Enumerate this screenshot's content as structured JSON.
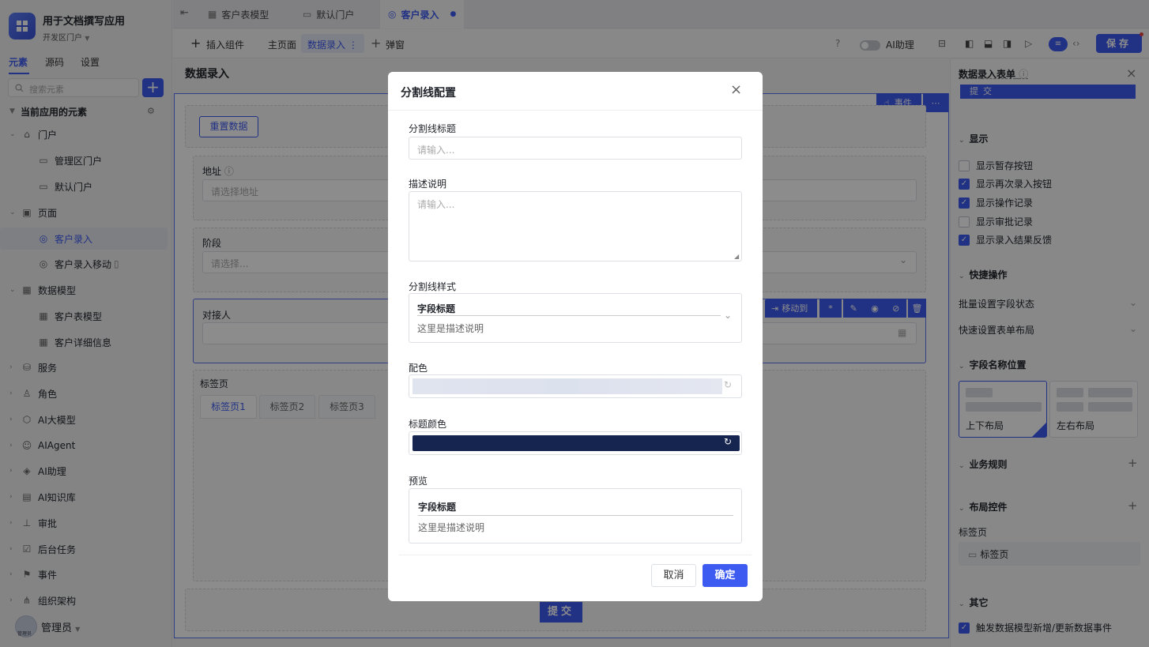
{
  "app": {
    "title": "用于文档撰写应用",
    "subtitle": "开发区门户"
  },
  "sidebar": {
    "tabs": [
      "元素",
      "源码",
      "设置"
    ],
    "search_placeholder": "搜索元素",
    "section_title": "当前应用的元素",
    "items": [
      {
        "label": "门户"
      },
      {
        "label": "管理区门户"
      },
      {
        "label": "默认门户"
      },
      {
        "label": "页面"
      },
      {
        "label": "客户录入"
      },
      {
        "label": "客户录入移动"
      },
      {
        "label": "数据模型"
      },
      {
        "label": "客户表模型"
      },
      {
        "label": "客户详细信息"
      },
      {
        "label": "服务"
      },
      {
        "label": "角色"
      },
      {
        "label": "AI大模型"
      },
      {
        "label": "AIAgent"
      },
      {
        "label": "AI助理"
      },
      {
        "label": "AI知识库"
      },
      {
        "label": "审批"
      },
      {
        "label": "后台任务"
      },
      {
        "label": "事件"
      },
      {
        "label": "组织架构"
      }
    ],
    "user": "管理员",
    "avatar_text": "管理员"
  },
  "top_tabs": [
    "客户表模型",
    "默认门户",
    "客户录入"
  ],
  "toolbar": {
    "insert": "插入组件",
    "main_page": "主页面",
    "data_entry": "数据录入",
    "popup": "弹窗",
    "ai_assistant": "AI助理",
    "save": "保存"
  },
  "canvas": {
    "page_title": "数据录入",
    "reset": "重置数据",
    "event": "事件",
    "address_label": "地址",
    "address_ph": "请选择地址",
    "stage_label": "阶段",
    "stage_ph": "请选择...",
    "contact_label": "对接人",
    "move_to": "移动到",
    "tabs_label": "标签页",
    "tabs": [
      "标签页1",
      "标签页2",
      "标签页3"
    ],
    "submit": "提交"
  },
  "right_panel": {
    "title": "数据录入表单",
    "top_btn": "提交",
    "display_title": "显示",
    "options": [
      {
        "label": "显示暂存按钮",
        "checked": false
      },
      {
        "label": "显示再次录入按钮",
        "checked": true
      },
      {
        "label": "显示操作记录",
        "checked": true
      },
      {
        "label": "显示审批记录",
        "checked": false
      },
      {
        "label": "显示录入结果反馈",
        "checked": true
      }
    ],
    "quick_ops": "快捷操作",
    "batch_status": "批量设置字段状态",
    "quick_layout": "快速设置表单布局",
    "field_name_pos": "字段名称位置",
    "layout_tb": "上下布局",
    "layout_lr": "左右布局",
    "biz_rules": "业务规则",
    "layout_ctrl": "布局控件",
    "tabs_label": "标签页",
    "tabs_item": "标签页",
    "other": "其它",
    "trigger": "触发数据模型新增/更新数据事件"
  },
  "modal": {
    "title": "分割线配置",
    "title_label": "分割线标题",
    "title_ph": "请输入...",
    "desc_label": "描述说明",
    "desc_ph": "请输入...",
    "style_label": "分割线样式",
    "style_title": "字段标题",
    "style_desc": "这里是描述说明",
    "color_label": "配色",
    "title_color_label": "标题颜色",
    "title_color": "#16254f",
    "preview_label": "预览",
    "preview_title": "字段标题",
    "preview_desc": "这里是描述说明",
    "cancel": "取消",
    "ok": "确定"
  },
  "colors": {
    "accent": "#3d5af1"
  }
}
